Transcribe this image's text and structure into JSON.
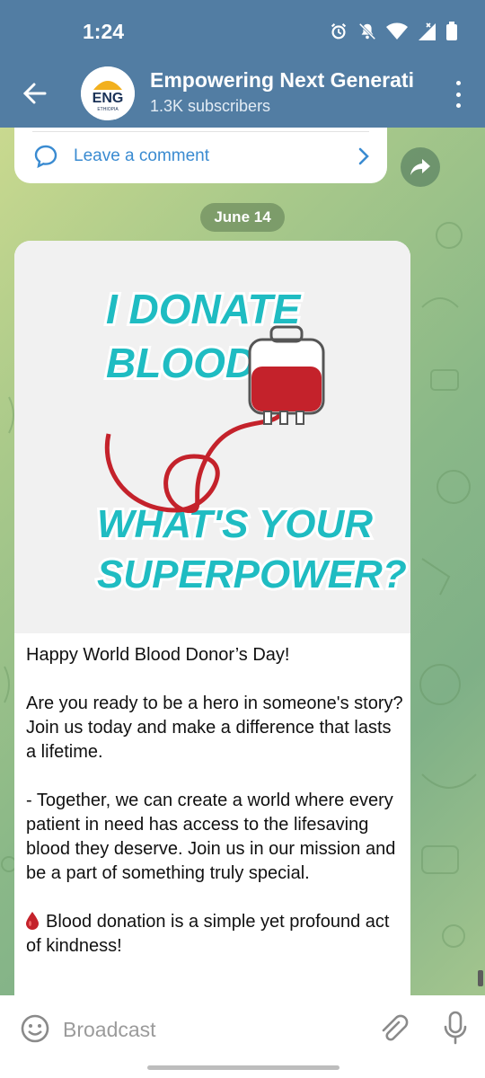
{
  "status": {
    "time": "1:24"
  },
  "header": {
    "title": "Empowering Next Generati",
    "subscribers": "1.3K subscribers",
    "avatar_text": "ENG",
    "avatar_subtext": "ETHIOPIA"
  },
  "previous_post": {
    "comment_label": "Leave a comment"
  },
  "date_pill": "June 14",
  "post": {
    "image_text": {
      "line1": "I DONATE",
      "line2": "BLOOD.",
      "line3": "WHAT'S YOUR",
      "line4": "SUPERPOWER?"
    },
    "paragraphs": [
      "Happy World Blood Donor’s Day!",
      "Are you ready to be a hero in someone's story? Join us today and make a difference that lasts a lifetime.",
      "- Together, we can create a world where every patient in need has access to the lifesaving blood they deserve. Join us in our mission and be a part of something truly special."
    ],
    "last_paragraph": "Blood donation is a simple yet profound act of kindness!"
  },
  "input": {
    "placeholder": "Broadcast"
  },
  "colors": {
    "header": "#527da3",
    "link": "#3a8bd1",
    "teal_text": "#1fbcc2",
    "blood": "#c4222b"
  },
  "icons": [
    "back-arrow-icon",
    "more-vert-icon",
    "comment-icon",
    "chevron-right-icon",
    "share-icon",
    "emoji-icon",
    "attach-icon",
    "mic-icon",
    "blood-drop-icon"
  ]
}
